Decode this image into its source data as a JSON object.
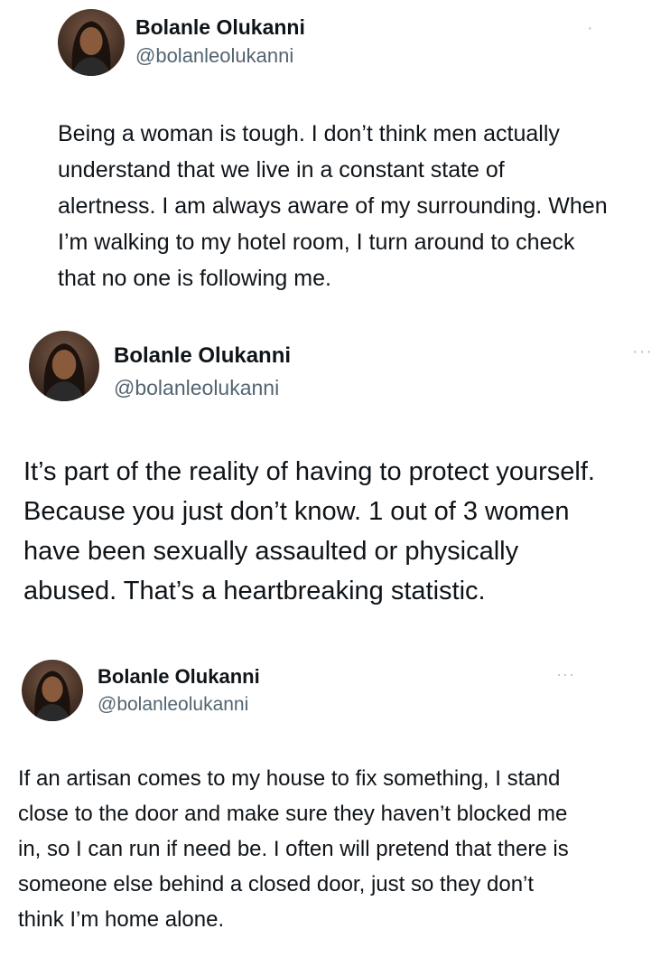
{
  "tweets": [
    {
      "author": "Bolanle Olukanni",
      "handle": "@bolanleolukanni",
      "more": "·",
      "text": "Being a woman is tough. I don’t think men actually understand that we live in a constant state of alertness. I am always aware of my surrounding. When I’m walking to my hotel room, I turn around to check that no one is following me."
    },
    {
      "author": "Bolanle Olukanni",
      "handle": "@bolanleolukanni",
      "more": "···",
      "text": "It’s part of the reality of having to protect yourself. Because you just don’t know. 1 out of 3 women have been sexually assaulted or physically abused. That’s a heartbreaking statistic."
    },
    {
      "author": "Bolanle Olukanni",
      "handle": "@bolanleolukanni",
      "more": "···",
      "text": "If an artisan comes to my house to fix something, I stand close to the door and make sure they haven’t blocked me in, so I can run if need be. I often will pretend that there is someone else behind a closed door, just so they don’t think I’m home alone."
    }
  ]
}
